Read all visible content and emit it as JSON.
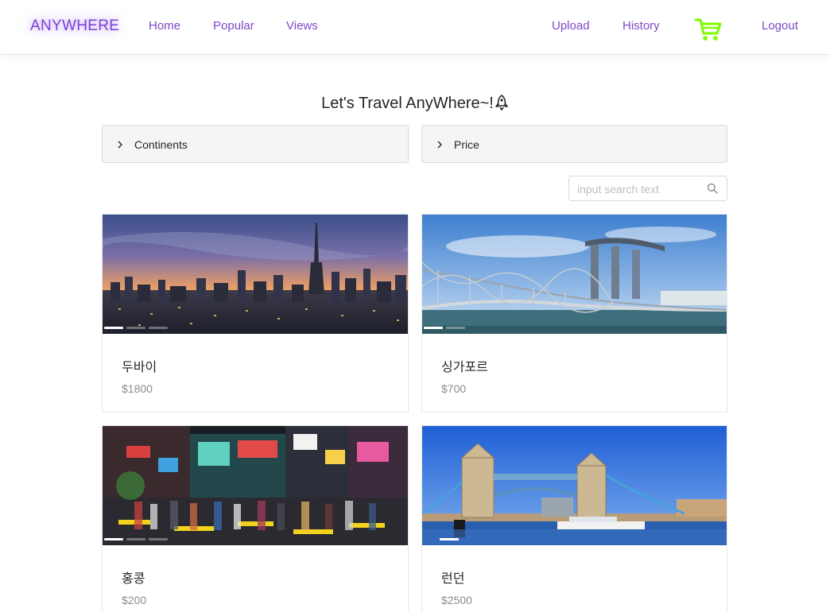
{
  "nav": {
    "logo": "ANYWHERE",
    "links": [
      "Home",
      "Popular",
      "Views"
    ],
    "upload": "Upload",
    "history": "History",
    "logout": "Logout",
    "cart_icon": "shopping-cart-icon",
    "cart_color": "#7cfc00",
    "accent": "#7b47c9"
  },
  "hero": {
    "title": "Let's Travel AnyWhere~!",
    "icon": "rocket-icon"
  },
  "filters": {
    "continents": "Continents",
    "price": "Price"
  },
  "search": {
    "placeholder": "input search text",
    "value": ""
  },
  "products": [
    {
      "name": "두바이",
      "price": "$1800",
      "image": "dubai-skyline-sunset"
    },
    {
      "name": "싱가포르",
      "price": "$700",
      "image": "singapore-marina-bay"
    },
    {
      "name": "홍콩",
      "price": "$200",
      "image": "hong-kong-night-crossing"
    },
    {
      "name": "런던",
      "price": "$2500",
      "image": "london-tower-bridge"
    }
  ]
}
